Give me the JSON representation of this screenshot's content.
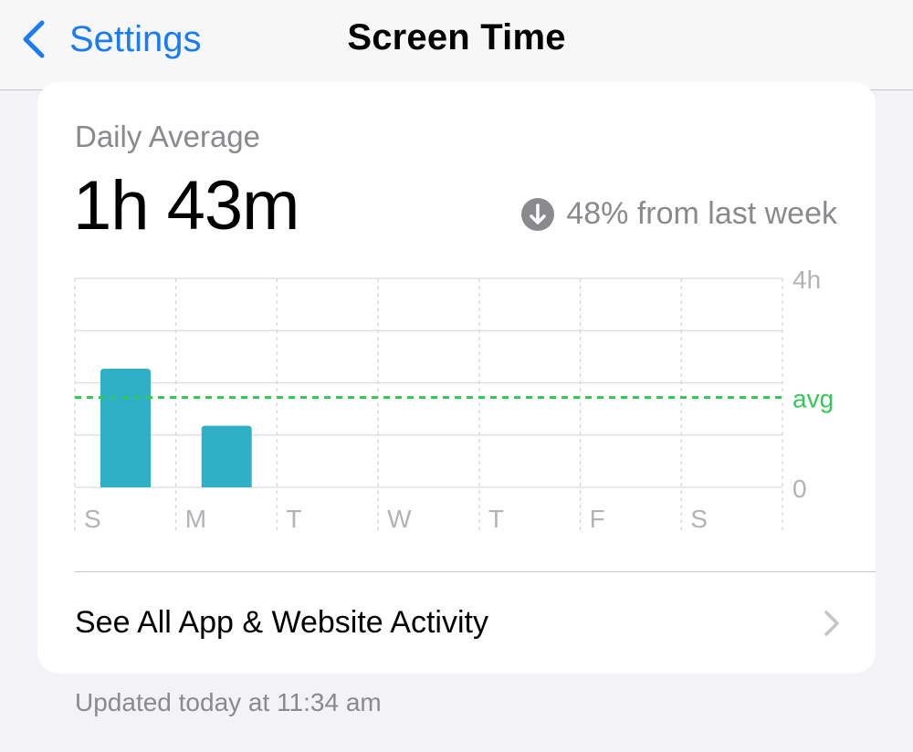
{
  "nav": {
    "back_label": "Settings",
    "title": "Screen Time"
  },
  "summary": {
    "daily_label": "Daily Average",
    "daily_value": "1h 43m",
    "change_text": "48% from last week",
    "change_icon": "arrow-down-circle-icon"
  },
  "chart_data": {
    "type": "bar",
    "categories": [
      "S",
      "M",
      "T",
      "W",
      "T",
      "F",
      "S"
    ],
    "values": [
      2.27,
      1.18,
      0,
      0,
      0,
      0,
      0
    ],
    "ylim": [
      0,
      4
    ],
    "y_tick_labels": [
      "4h",
      "0"
    ],
    "average": 1.72,
    "average_label": "avg",
    "grid": true,
    "bar_color": "#30b0c7",
    "average_color": "#34c759"
  },
  "activity": {
    "label": "See All App & Website Activity"
  },
  "footer": {
    "updated_text": "Updated today at 11:34 am"
  },
  "colors": {
    "accent": "#1a7cf2",
    "background": "#f2f2f7"
  }
}
